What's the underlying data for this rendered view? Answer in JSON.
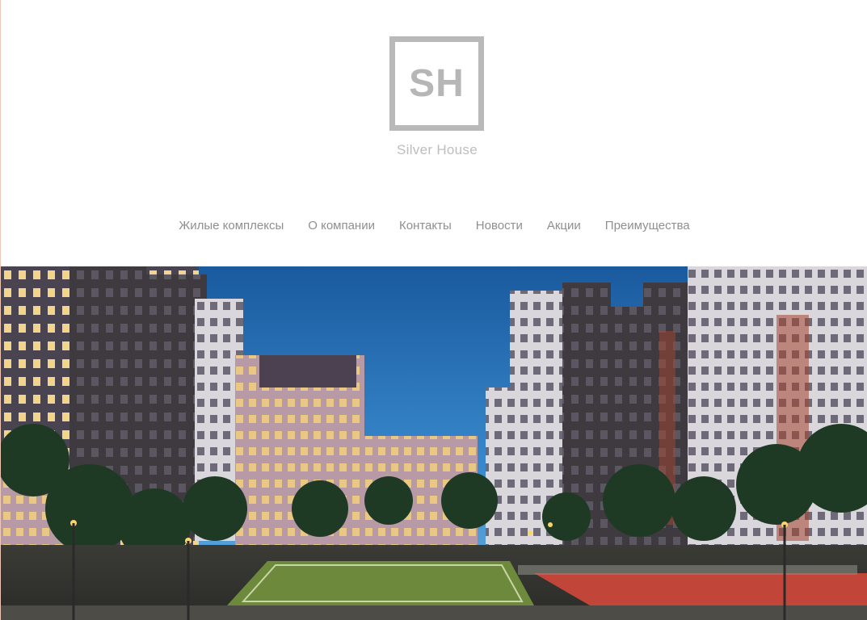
{
  "brand": {
    "logo_letters": "SH",
    "name": "Silver House"
  },
  "nav": {
    "items": [
      {
        "label": "Жилые комплексы"
      },
      {
        "label": "О компании"
      },
      {
        "label": "Контакты"
      },
      {
        "label": "Новости"
      },
      {
        "label": "Акции"
      },
      {
        "label": "Преимущества"
      }
    ]
  },
  "colors": {
    "logo_gray": "#b9b9b9",
    "nav_text": "#8f8f8f",
    "sky_top": "#1d63a8",
    "sky_bottom": "#3f95d6"
  },
  "hero": {
    "image": "photo-residential-complex-night"
  }
}
